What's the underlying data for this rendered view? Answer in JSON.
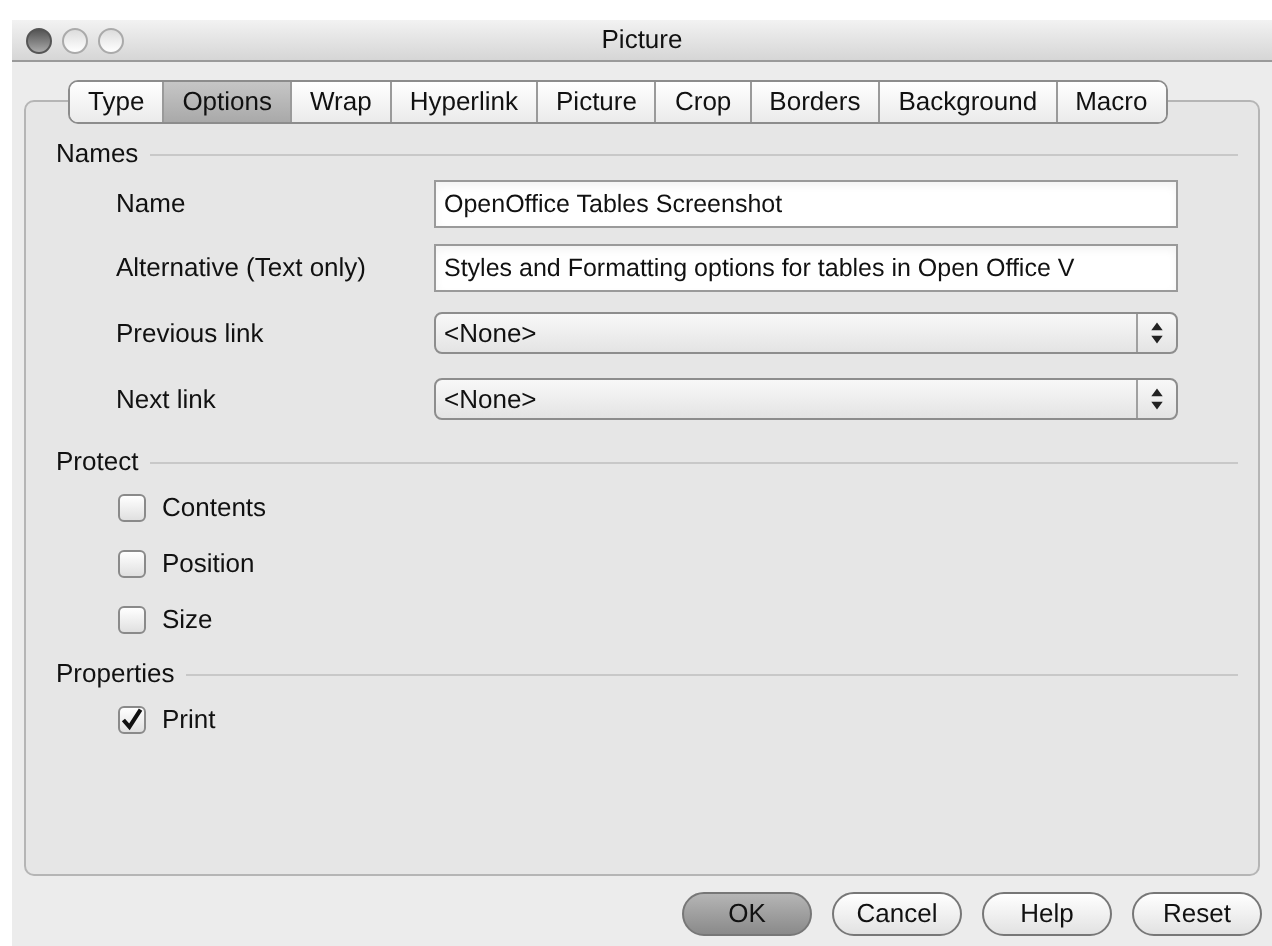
{
  "window": {
    "title": "Picture"
  },
  "tabs": [
    {
      "label": "Type",
      "selected": false
    },
    {
      "label": "Options",
      "selected": true
    },
    {
      "label": "Wrap",
      "selected": false
    },
    {
      "label": "Hyperlink",
      "selected": false
    },
    {
      "label": "Picture",
      "selected": false
    },
    {
      "label": "Crop",
      "selected": false
    },
    {
      "label": "Borders",
      "selected": false
    },
    {
      "label": "Background",
      "selected": false
    },
    {
      "label": "Macro",
      "selected": false
    }
  ],
  "sections": [
    {
      "title": "Names",
      "items": [
        {
          "kind": "text",
          "label": "Name",
          "value": "OpenOffice Tables Screenshot"
        },
        {
          "kind": "text",
          "label": "Alternative (Text only)",
          "value": "Styles and Formatting options for tables in Open Office V"
        },
        {
          "kind": "select",
          "label": "Previous link",
          "value": "<None>"
        },
        {
          "kind": "select",
          "label": "Next link",
          "value": "<None>"
        }
      ]
    },
    {
      "title": "Protect",
      "items": [
        {
          "kind": "checkbox",
          "label": "Contents",
          "checked": false
        },
        {
          "kind": "checkbox",
          "label": "Position",
          "checked": false
        },
        {
          "kind": "checkbox",
          "label": "Size",
          "checked": false
        }
      ]
    },
    {
      "title": "Properties",
      "items": [
        {
          "kind": "checkbox",
          "label": "Print",
          "checked": true
        }
      ]
    }
  ],
  "buttons": [
    {
      "label": "OK",
      "default": true
    },
    {
      "label": "Cancel",
      "default": false
    },
    {
      "label": "Help",
      "default": false
    },
    {
      "label": "Reset",
      "default": false
    }
  ]
}
